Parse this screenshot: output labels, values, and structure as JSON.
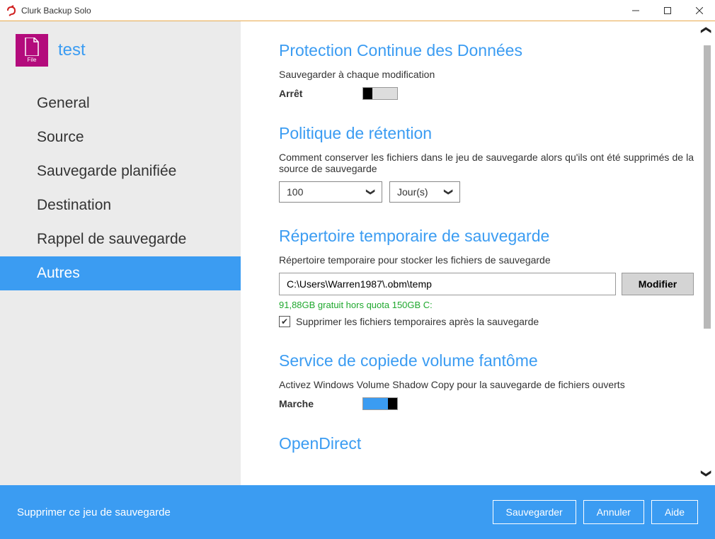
{
  "window": {
    "title": "Clurk Backup Solo"
  },
  "profile": {
    "name": "test",
    "icon_label": "File"
  },
  "nav": {
    "items": [
      {
        "label": "General"
      },
      {
        "label": "Source"
      },
      {
        "label": "Sauvegarde planifiée"
      },
      {
        "label": "Destination"
      },
      {
        "label": "Rappel de sauvegarde"
      },
      {
        "label": "Autres"
      }
    ],
    "active_index": 5
  },
  "sections": {
    "cdp": {
      "title": "Protection Continue des Données",
      "desc": "Sauvegarder à chaque modification",
      "toggle_label": "Arrêt",
      "toggle_state": "off"
    },
    "retention": {
      "title": "Politique de rétention",
      "desc": "Comment conserver les fichiers dans le jeu de sauvegarde alors qu'ils ont été supprimés de la source de sauvegarde",
      "value": "100",
      "unit": "Jour(s)"
    },
    "tempdir": {
      "title": "Répertoire temporaire de sauvegarde",
      "desc": "Répertoire temporaire pour stocker les fichiers de sauvegarde",
      "path": "C:\\Users\\Warren1987\\.obm\\temp",
      "modify_label": "Modifier",
      "free_space": "91,88GB gratuit hors quota 150GB C:",
      "delete_temp_checked": true,
      "delete_temp_label": "Supprimer les fichiers temporaires après la sauvegarde"
    },
    "vss": {
      "title": "Service de copiede volume fantôme",
      "desc": "Activez Windows Volume Shadow Copy pour la sauvegarde de fichiers ouverts",
      "toggle_label": "Marche",
      "toggle_state": "on"
    },
    "opendirect": {
      "title": "OpenDirect"
    }
  },
  "footer": {
    "delete_label": "Supprimer ce jeu de sauvegarde",
    "save_label": "Sauvegarder",
    "cancel_label": "Annuler",
    "help_label": "Aide"
  }
}
